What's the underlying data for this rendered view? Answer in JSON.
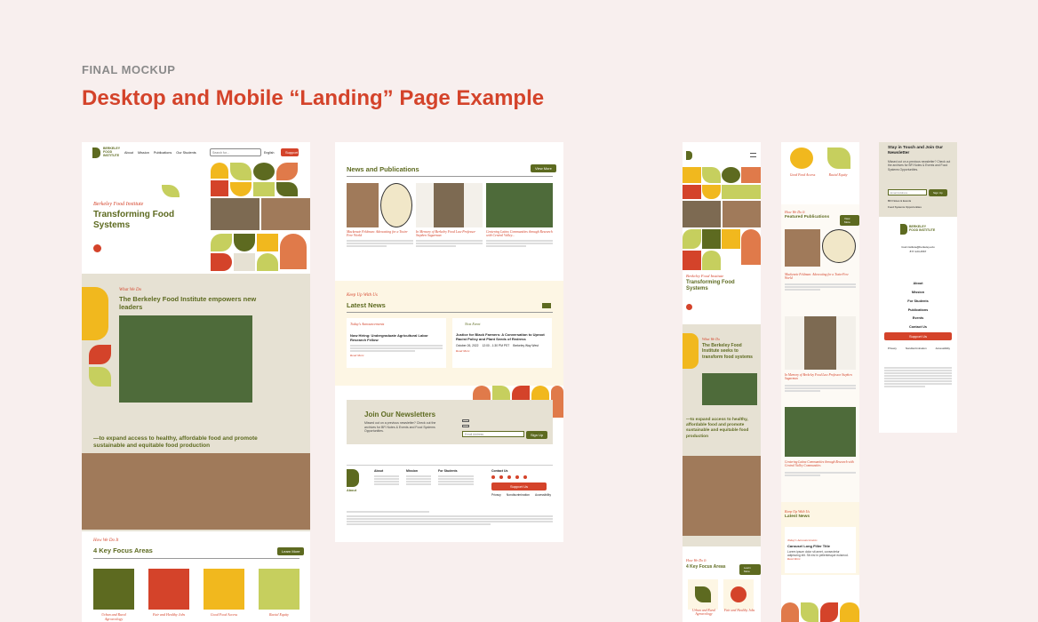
{
  "header": {
    "kicker": "FINAL MOCKUP",
    "title": "Desktop and Mobile “Landing” Page Example"
  },
  "colors": {
    "bg": "#f8efee",
    "accent": "#d4432a",
    "olive": "#5d6a20",
    "yellow": "#f1b81e",
    "lime": "#c6cf5e",
    "cream": "#fdf6e4",
    "sand": "#e6e1d3"
  },
  "d1": {
    "logo": "BERKELEY FOOD INSTITUTE",
    "nav": [
      "About",
      "Mission",
      "Publications",
      "Our Students"
    ],
    "search_placeholder": "Search for...",
    "lang": "English",
    "support": "Support",
    "hero_kicker": "Berkeley Food Institute",
    "hero_title": "Transforming Food Systems",
    "what_kicker": "What We Do",
    "what_title": "The Berkeley Food Institute empowers new leaders",
    "mission": "—to expand access to healthy, affordable food and promote sustainable and equitable food production",
    "how_kicker": "How We Do It",
    "areas_title": "4 Key Focus Areas",
    "learn_more": "Learn More",
    "areas": [
      "Urban and Rural Agroecology",
      "Fair and Healthy Jobs",
      "Good Food Access",
      "Racial Equity"
    ]
  },
  "d2": {
    "news_title": "News and Publications",
    "view_more": "View More",
    "stories": [
      {
        "title": "Mackenzie Feldman: Advocating for a Toxin-Free World"
      },
      {
        "title": "In Memory of Berkeley Food Law Professor Stephen Sugarman"
      },
      {
        "title": "Centering Latinx Communities through Research with Central Valley..."
      }
    ],
    "keep_kicker": "Keep Up With Us",
    "latest_title": "Latest News",
    "announce_tag": "Today's Announcements",
    "announce_title": "Now Hiring: Undergraduate Agricultural Labor Research Fellow",
    "event_tag": "Next Event",
    "event_title": "Justice for Black Farmers: A Conversation to Uproot Racist Policy and Plant Seeds of Redress",
    "event_date": "October 26, 2022",
    "event_time": "12:00 - 1:30 PM PST",
    "event_place": "Berkeley Way West",
    "read_more": "Read More",
    "newsletter_title": "Join Our Newsletters",
    "newsletter_text": "Missed out on a previous newsletter? Check out the archives for BFI Notes & Events and Food Systems Opportunities.",
    "email_placeholder": "Email Address",
    "signup": "Sign Up",
    "footer_cols": [
      "About",
      "Mission",
      "For Students",
      "Contact Us"
    ],
    "support_us": "Support Us",
    "footer_links": [
      "Privacy",
      "Nondiscrimination",
      "Accessibility"
    ]
  },
  "m1": {
    "hero_kicker": "Berkeley Food Institute",
    "hero_title": "Transforming Food Systems",
    "what_kicker": "What We Do",
    "what_title": "The Berkeley Food Institute seeks to transform food systems",
    "mission": "—to expand access to healthy, affordable food and promote sustainable and equitable food production",
    "how_kicker": "How We Do It",
    "areas_title": "4 Key Focus Areas",
    "learn_more": "Learn More",
    "areas": [
      "Urban and Rural Agroecology",
      "Fair and Healthy Jobs"
    ]
  },
  "m2": {
    "labels": [
      "Good Food Access",
      "Racial Equity"
    ],
    "how_kicker": "How We Do It",
    "featured": "Featured Publications",
    "view_more": "View More",
    "stories": [
      "Mackenzie Feldman: Advocating for a Toxin-Free World",
      "In Memory of Berkeley Food Law Professor Stephen Sugarman",
      "Centering Latinx Communities through Research with Central Valley Communities"
    ],
    "keep_kicker": "Keep Up With Us",
    "latest": "Latest News",
    "announce_tag": "Today's Announcements",
    "carousel_title": "Carousel Long Filler Title",
    "carousel_text": "Lorem ipsum dolor sit amet, consectetur adipiscing elit. Sit nisl in pellentesque euismod.",
    "read_more": "Read More"
  },
  "m3": {
    "stay_title": "Stay in Touch and Join Our Newsletter",
    "stay_text": "Missed out on a previous newsletter? Check out the archives for BFI Notes & Events and Food Systems Opportunities.",
    "email_placeholder": "Email Address",
    "signup": "Sign Up",
    "check1": "BFI Notes & Events",
    "check2": "Food Systems Opportunities",
    "logo": "BERKELEY FOOD INSTITUTE",
    "email": "food.institute@berkeley.edu",
    "phone": "877-123-4567",
    "nav": [
      "About",
      "Mission",
      "For Students",
      "Publications",
      "Events",
      "Contact Us"
    ],
    "support": "Support Us",
    "links": [
      "Privacy",
      "Nondiscrimination",
      "Accessibility"
    ]
  }
}
